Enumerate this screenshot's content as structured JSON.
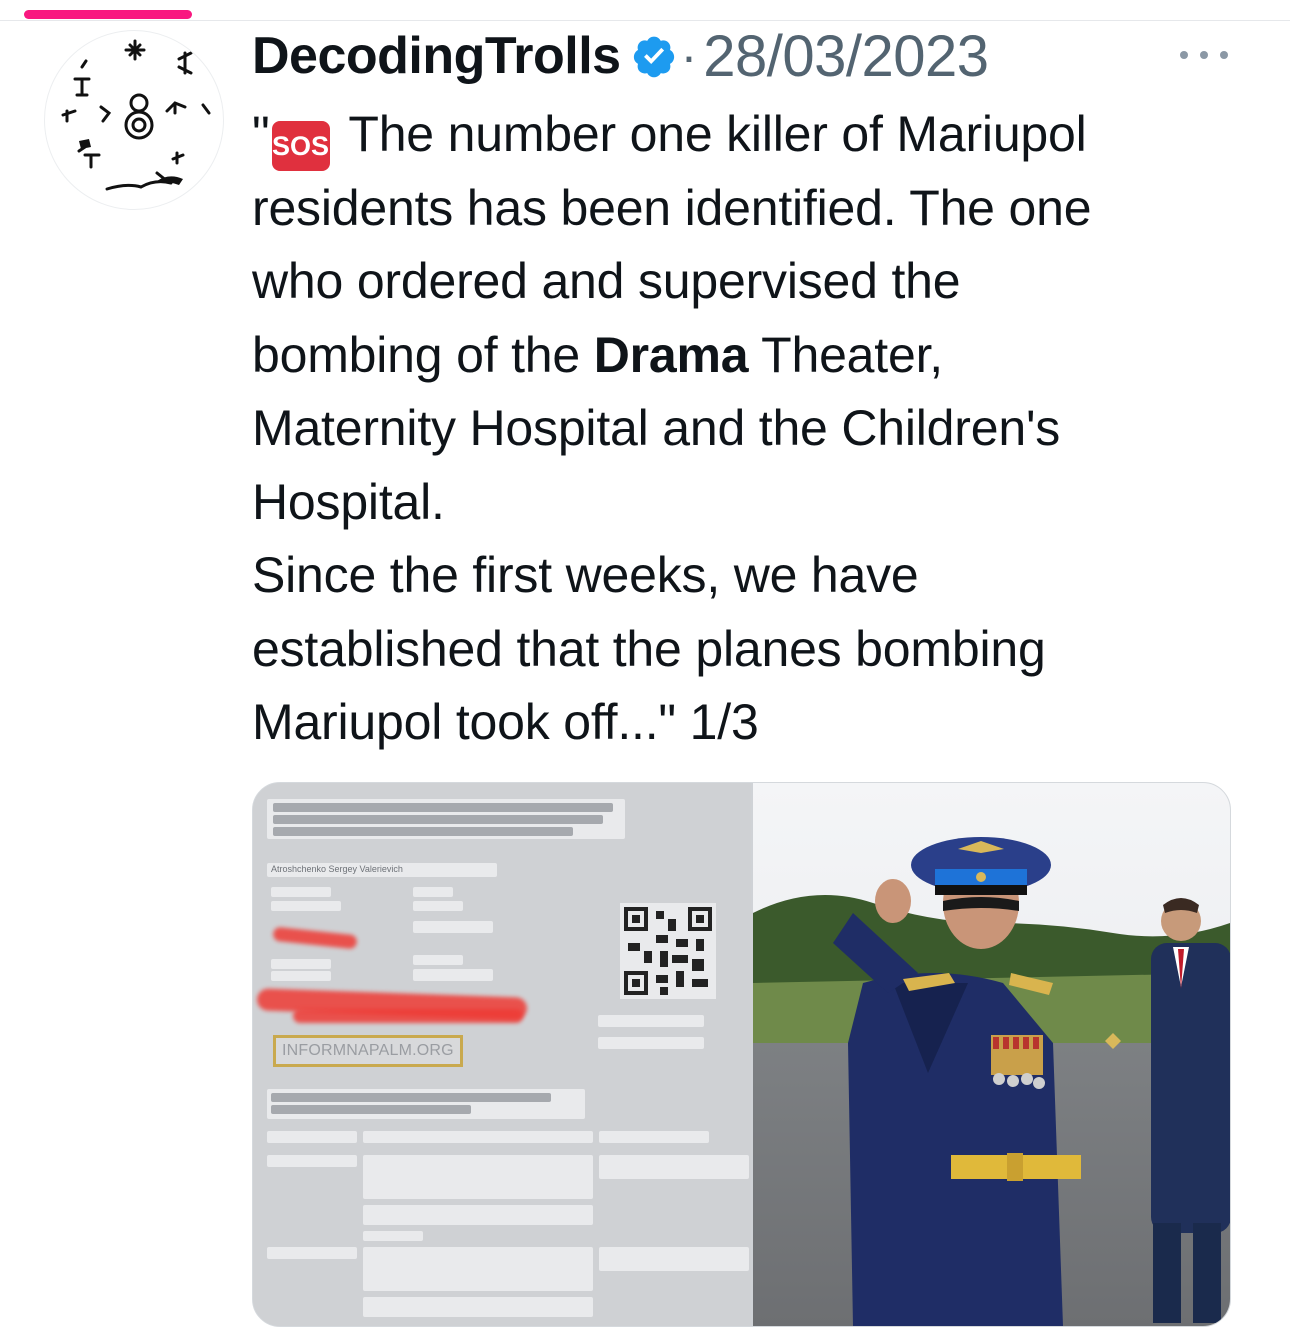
{
  "tweet": {
    "author": "DecodingTrolls",
    "separator": "·",
    "date": "28/03/2023",
    "more_icon": "more-horizontal-icon",
    "verified_icon": "verified-badge-icon",
    "verified_color": "#1d9bf0",
    "text": {
      "quote_open": "\"",
      "emoji": "SOS",
      "line1": " The number one killer of Mariupol",
      "line2": "residents has been identified. The one",
      "line3": "who ordered and supervised the",
      "line4_pre": "bombing of the ",
      "line4_bold": "Drama",
      "line4_post": " Theater,",
      "line5": "Maternity Hospital and the Children's",
      "line6": "Hospital.",
      "line7": "Since the first weeks, we have",
      "line8": "established that the planes bombing",
      "line9": "Mariupol took off...\" 1/3"
    }
  },
  "media": {
    "document": {
      "name": "Atroshchenko Sergey Valerievich",
      "watermark": "INFORMNAPALM.ORG"
    }
  },
  "colors": {
    "accent_bar": "#f91880",
    "secondary_text": "#536471",
    "sos_emoji": "#e0303e"
  }
}
